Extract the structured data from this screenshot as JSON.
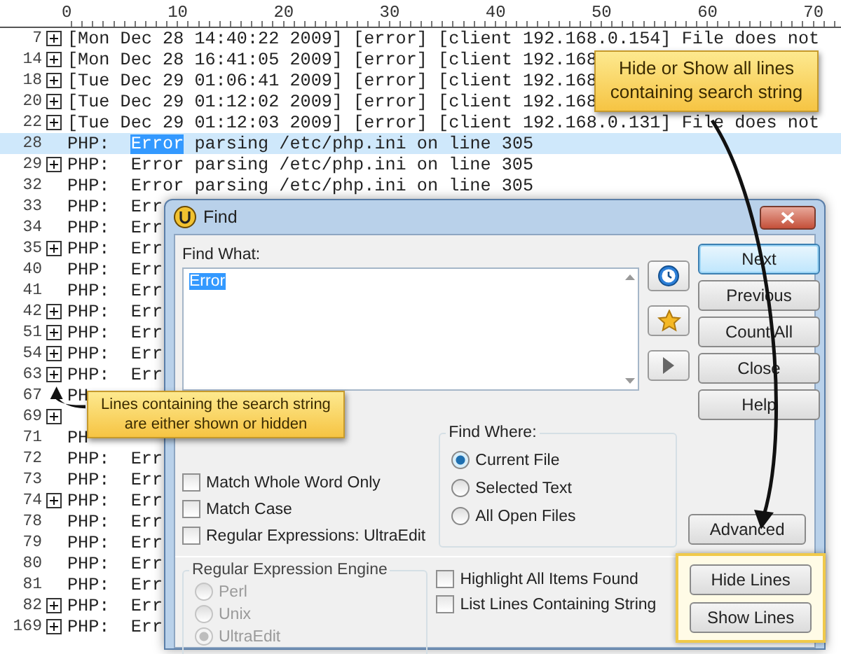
{
  "ruler": {
    "labels": [
      "0",
      "10",
      "20",
      "30",
      "40",
      "50",
      "60",
      "70"
    ]
  },
  "editor": {
    "lines": [
      {
        "number": "7",
        "foldable": true,
        "selected": false,
        "text": "[Mon Dec 28 14:40:22 2009] [error] [client 192.168.0.154] File does not"
      },
      {
        "number": "14",
        "foldable": true,
        "selected": false,
        "text": "[Mon Dec 28 16:41:05 2009] [error] [client 192.168"
      },
      {
        "number": "18",
        "foldable": true,
        "selected": false,
        "text": "[Tue Dec 29 01:06:41 2009] [error] [client 192.168"
      },
      {
        "number": "20",
        "foldable": true,
        "selected": false,
        "text": "[Tue Dec 29 01:12:02 2009] [error] [client 192.168"
      },
      {
        "number": "22",
        "foldable": true,
        "selected": false,
        "text": "[Tue Dec 29 01:12:03 2009] [error] [client 192.168.0.131] File does not"
      },
      {
        "number": "28",
        "foldable": false,
        "selected": true,
        "text": "PHP:  ",
        "match": "Error",
        "after": " parsing /etc/php.ini on line 305"
      },
      {
        "number": "29",
        "foldable": true,
        "selected": false,
        "text": "PHP:  Error parsing /etc/php.ini on line 305"
      },
      {
        "number": "32",
        "foldable": false,
        "selected": false,
        "text": "PHP:  Error parsing /etc/php.ini on line 305"
      },
      {
        "number": "33",
        "foldable": false,
        "selected": false,
        "text": "PHP:  Err"
      },
      {
        "number": "34",
        "foldable": false,
        "selected": false,
        "text": "PHP:  Err"
      },
      {
        "number": "35",
        "foldable": true,
        "selected": false,
        "text": "PHP:  Err"
      },
      {
        "number": "40",
        "foldable": false,
        "selected": false,
        "text": "PHP:  Err"
      },
      {
        "number": "41",
        "foldable": false,
        "selected": false,
        "text": "PHP:  Err"
      },
      {
        "number": "42",
        "foldable": true,
        "selected": false,
        "text": "PHP:  Err"
      },
      {
        "number": "51",
        "foldable": true,
        "selected": false,
        "text": "PHP:  Err"
      },
      {
        "number": "54",
        "foldable": true,
        "selected": false,
        "text": "PHP:  Err"
      },
      {
        "number": "63",
        "foldable": true,
        "selected": false,
        "text": "PHP:  Err"
      },
      {
        "number": "67",
        "foldable": false,
        "selected": false,
        "text": "PH"
      },
      {
        "number": "69",
        "foldable": true,
        "selected": false
      },
      {
        "number": "71",
        "foldable": false,
        "selected": false,
        "text": "PH"
      },
      {
        "number": "72",
        "foldable": false,
        "selected": false,
        "text": "PHP:  Err"
      },
      {
        "number": "73",
        "foldable": false,
        "selected": false,
        "text": "PHP:  Err"
      },
      {
        "number": "74",
        "foldable": true,
        "selected": false,
        "text": "PHP:  Err"
      },
      {
        "number": "78",
        "foldable": false,
        "selected": false,
        "text": "PHP:  Err"
      },
      {
        "number": "79",
        "foldable": false,
        "selected": false,
        "text": "PHP:  Err"
      },
      {
        "number": "80",
        "foldable": false,
        "selected": false,
        "text": "PHP:  Err"
      },
      {
        "number": "81",
        "foldable": false,
        "selected": false,
        "text": "PHP:  Err"
      },
      {
        "number": "82",
        "foldable": true,
        "selected": false,
        "text": "PHP:  Err"
      },
      {
        "number": "169",
        "foldable": true,
        "selected": false,
        "text": "PHP:  Err"
      }
    ]
  },
  "find_dialog": {
    "title": "Find",
    "find_what_label": "Find What:",
    "find_what_value": "Error",
    "buttons": [
      {
        "label": "Next",
        "default": true
      },
      {
        "label": "Previous",
        "default": false
      },
      {
        "label": "Count All",
        "default": false
      },
      {
        "label": "Close",
        "default": false
      },
      {
        "label": "Help",
        "default": false
      }
    ],
    "options": [
      {
        "label": "Match Whole Word Only",
        "checked": false
      },
      {
        "label": "Match Case",
        "checked": false
      },
      {
        "label": "Regular Expressions: UltraEdit",
        "checked": false
      }
    ],
    "find_where": {
      "label": "Find Where:",
      "options": [
        {
          "label": "Current File",
          "selected": true
        },
        {
          "label": "Selected Text",
          "selected": false
        },
        {
          "label": "All Open Files",
          "selected": false
        }
      ]
    },
    "advanced_button": "Advanced",
    "regex_engine": {
      "label": "Regular Expression Engine",
      "disabled": true,
      "options": [
        {
          "label": "Perl",
          "selected": false
        },
        {
          "label": "Unix",
          "selected": false
        },
        {
          "label": "UltraEdit",
          "selected": true
        }
      ]
    },
    "list_options": [
      {
        "label": "Highlight All Items Found",
        "checked": false
      },
      {
        "label": "List Lines Containing String",
        "checked": false
      }
    ],
    "line_buttons": [
      "Hide Lines",
      "Show Lines"
    ]
  },
  "callouts": [
    {
      "text": "Hide or Show all lines containing search string"
    },
    {
      "text": "Lines containing the search string are either shown or hidden"
    }
  ]
}
